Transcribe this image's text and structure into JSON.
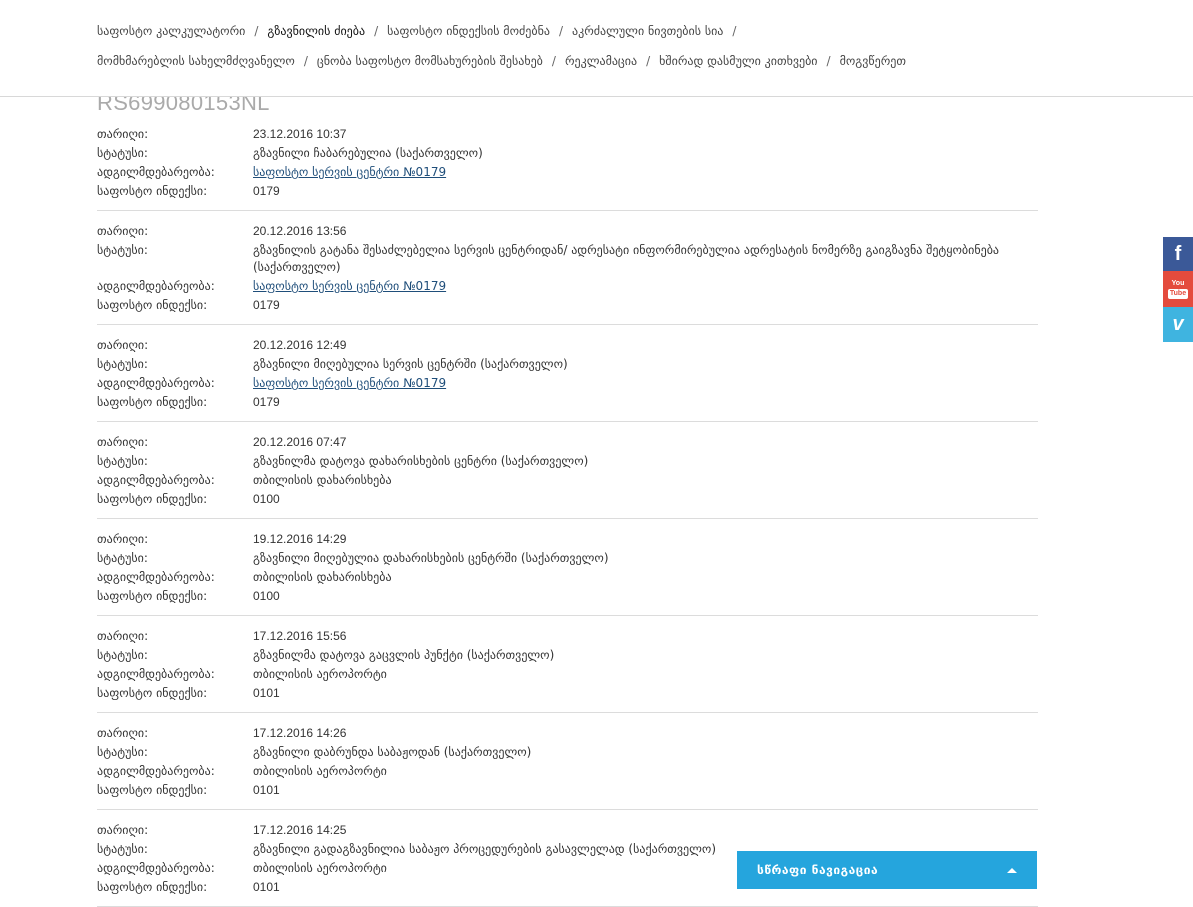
{
  "nav": {
    "row1": [
      {
        "label": "საფოსტო კალკულატორი",
        "active": false
      },
      {
        "label": "გზავნილის ძიება",
        "active": true
      },
      {
        "label": "საფოსტო ინდექსის მოძებნა",
        "active": false
      },
      {
        "label": "აკრძალული ნივთების სია",
        "active": false
      }
    ],
    "row2": [
      {
        "label": "მომხმარებლის სახელმძღვანელო",
        "active": false
      },
      {
        "label": "ცნობა საფოსტო მომსახურების შესახებ",
        "active": false
      },
      {
        "label": "რეკლამაცია",
        "active": false
      },
      {
        "label": "ხშირად დასმული კითხვები",
        "active": false
      },
      {
        "label": "მოგვწერეთ",
        "active": false
      }
    ],
    "separator": "/"
  },
  "tracking_number": "RS699080153NL",
  "labels": {
    "date": "თარიღი:",
    "status": "სტატუსი:",
    "location": "ადგილმდებარეობა:",
    "index": "საფოსტო ინდექსი:"
  },
  "entries": [
    {
      "date": "23.12.2016 10:37",
      "status": "გზავნილი ჩაბარებულია (საქართველო)",
      "location": "საფოსტო სერვის ცენტრი №0179",
      "location_link": true,
      "index": "0179"
    },
    {
      "date": "20.12.2016 13:56",
      "status": "გზავნილის გატანა შესაძლებელია სერვის ცენტრიდან/ ადრესატი ინფორმირებულია ადრესატის ნომერზე გაიგზავნა შეტყობინება (საქართველო)",
      "location": "საფოსტო სერვის ცენტრი №0179",
      "location_link": true,
      "index": "0179"
    },
    {
      "date": "20.12.2016 12:49",
      "status": "გზავნილი მიღებულია სერვის ცენტრში (საქართველო)",
      "location": "საფოსტო სერვის ცენტრი №0179",
      "location_link": true,
      "index": "0179"
    },
    {
      "date": "20.12.2016 07:47",
      "status": "გზავნილმა დატოვა დახარისხების ცენტრი (საქართველო)",
      "location": "თბილისის დახარისხება",
      "location_link": false,
      "index": "0100"
    },
    {
      "date": "19.12.2016 14:29",
      "status": "გზავნილი მიღებულია დახარისხების ცენტრში (საქართველო)",
      "location": "თბილისის დახარისხება",
      "location_link": false,
      "index": "0100"
    },
    {
      "date": "17.12.2016 15:56",
      "status": "გზავნილმა დატოვა გაცვლის პუნქტი (საქართველო)",
      "location": "თბილისის აეროპორტი",
      "location_link": false,
      "index": "0101"
    },
    {
      "date": "17.12.2016 14:26",
      "status": "გზავნილი დაბრუნდა საბაჟოდან (საქართველო)",
      "location": "თბილისის აეროპორტი",
      "location_link": false,
      "index": "0101"
    },
    {
      "date": "17.12.2016 14:25",
      "status": "გზავნილი გადაგზავნილია საბაჟო პროცედურების გასავლელად (საქართველო)",
      "location": "თბილისის აეროპორტი",
      "location_link": false,
      "index": "0101"
    }
  ],
  "social": [
    {
      "name": "facebook",
      "icon": "facebook-icon",
      "glyph": "f",
      "color": "#3b5998"
    },
    {
      "name": "youtube",
      "icon": "youtube-icon",
      "glyph_top": "You",
      "glyph_bottom": "Tube",
      "color": "#e44b3d"
    },
    {
      "name": "vimeo",
      "icon": "vimeo-icon",
      "glyph": "v",
      "color": "#3fb4e0"
    }
  ],
  "quick_nav": {
    "label": "სწრაფი ნავიგაცია",
    "color": "#25a5dd"
  }
}
